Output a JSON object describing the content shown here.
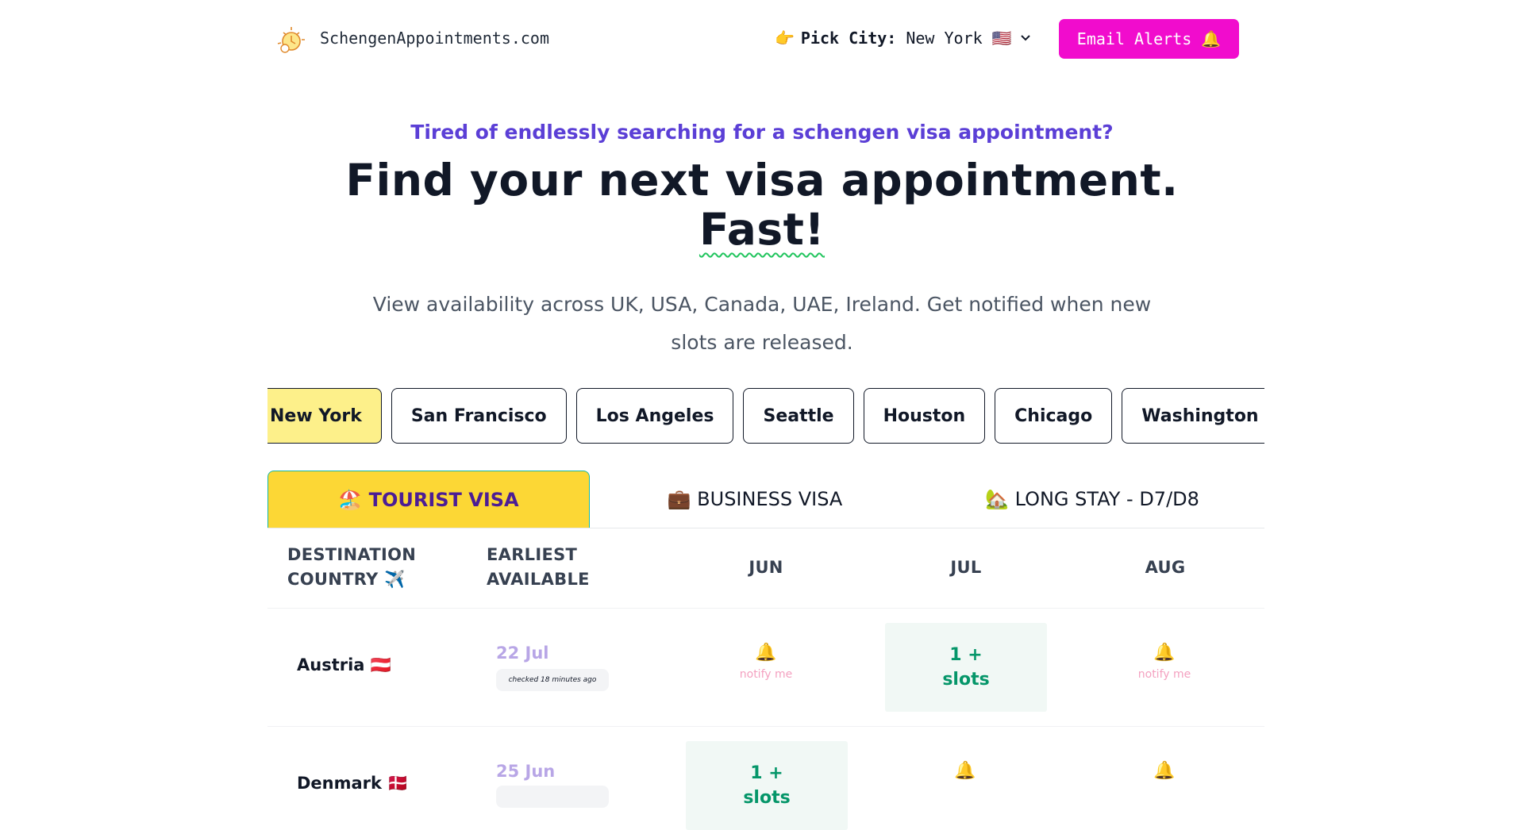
{
  "header": {
    "site_name": "SchengenAppointments.com",
    "logo_icon": "alarm-clock-icon",
    "city_picker": {
      "pointer": "👉",
      "label": "Pick City:",
      "value": "New York",
      "flag": "🇺🇸"
    },
    "email_alerts_label": "Email Alerts 🔔"
  },
  "hero": {
    "eyebrow": "Tired of endlessly searching for a schengen visa appointment?",
    "headline_line1": "Find your next visa appointment.",
    "headline_line2": "Fast!",
    "subtext": "View availability across UK, USA, Canada, UAE, Ireland. Get notified when new slots are released."
  },
  "city_tabs": [
    {
      "label": "New York",
      "active": true
    },
    {
      "label": "San Francisco",
      "active": false
    },
    {
      "label": "Los Angeles",
      "active": false
    },
    {
      "label": "Seattle",
      "active": false
    },
    {
      "label": "Houston",
      "active": false
    },
    {
      "label": "Chicago",
      "active": false
    },
    {
      "label": "Washington DC",
      "active": false
    }
  ],
  "visa_tabs": [
    {
      "label": "🏖️ TOURIST VISA",
      "active": true
    },
    {
      "label": "💼 BUSINESS VISA",
      "active": false
    },
    {
      "label": "🏡 LONG STAY - D7/D8",
      "active": false
    }
  ],
  "table": {
    "headers": {
      "country_line1": "DESTINATION",
      "country_line2": "COUNTRY ✈️",
      "earliest_line1": "EARLIEST",
      "earliest_line2": "AVAILABLE",
      "m1": "JUN",
      "m2": "JUL",
      "m3": "AUG"
    },
    "rows": [
      {
        "country": "Austria 🇦🇹",
        "earliest": "22 Jul",
        "checked": "checked 18 minutes ago",
        "jun": {
          "type": "notify",
          "bell": "🔔",
          "text": "notify me"
        },
        "jul": {
          "type": "slots",
          "line1": "1 +",
          "line2": "slots"
        },
        "aug": {
          "type": "notify",
          "bell": "🔔",
          "text": "notify me"
        }
      },
      {
        "country": "Denmark 🇩🇰",
        "earliest": "25 Jun",
        "jun": {
          "type": "slots",
          "line1": "1 +",
          "line2": "slots"
        },
        "jul": {
          "type": "notify",
          "bell": "🔔"
        },
        "aug": {
          "type": "notify",
          "bell": "🔔"
        }
      }
    ]
  },
  "colors": {
    "accent_pink": "#f10ccd",
    "eyebrow_purple": "#5b3fd6",
    "active_city_bg": "#fdf08a",
    "active_visa_bg": "#fcd735",
    "slots_green": "#059669"
  }
}
